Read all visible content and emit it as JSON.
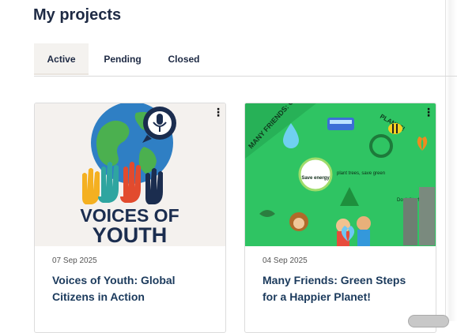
{
  "page": {
    "title": "My projects"
  },
  "tabs": [
    {
      "label": "Active",
      "selected": true
    },
    {
      "label": "Pending",
      "selected": false
    },
    {
      "label": "Closed",
      "selected": false
    }
  ],
  "projects": [
    {
      "date": "07 Sep 2025",
      "title": "Voices of Youth: Global Citizens in Action",
      "image_text": [
        "VOICES OF",
        "YOUTH"
      ],
      "menu_icon": "kebab-icon"
    },
    {
      "date": "04 Sep 2025",
      "title": "Many Friends: Green Steps for a Happier Planet!",
      "image_text": [
        "MANY FRIENDS: GR",
        "PLANET!",
        "Save energy",
        "plant trees, save green",
        "Don't litter!"
      ],
      "menu_icon": "kebab-icon"
    }
  ],
  "colors": {
    "title": "#1e2a44",
    "card_title": "#1b3a5c",
    "active_tab_bg": "#f4f2ef",
    "green_image_bg": "#2fc463"
  }
}
